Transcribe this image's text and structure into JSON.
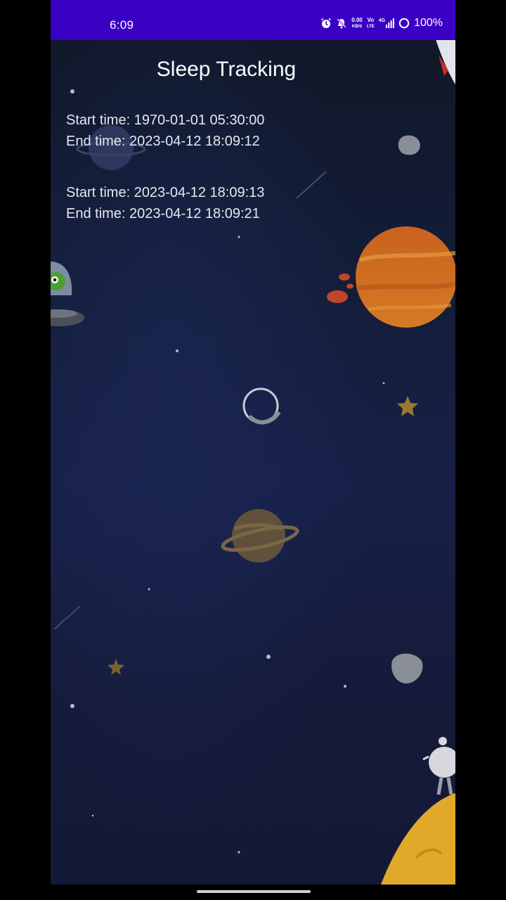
{
  "status_bar": {
    "time": "6:09",
    "net_speed_value": "0.00",
    "net_speed_unit": "KB/S",
    "volte_top": "Vo",
    "volte_bottom": "LTE",
    "signal_label": "4G",
    "battery": "100%",
    "background_color": "#3a00c4"
  },
  "app": {
    "title": "Sleep Tracking"
  },
  "records": [
    {
      "start": "Start time: 1970-01-01 05:30:00",
      "end": "End time: 2023-04-12 18:09:12"
    },
    {
      "start": "Start time: 2023-04-12 18:09:13",
      "end": "End time: 2023-04-12 18:09:21"
    }
  ],
  "theme": {
    "background_color": "#141d3a",
    "text_color": "#e6e8ee"
  }
}
